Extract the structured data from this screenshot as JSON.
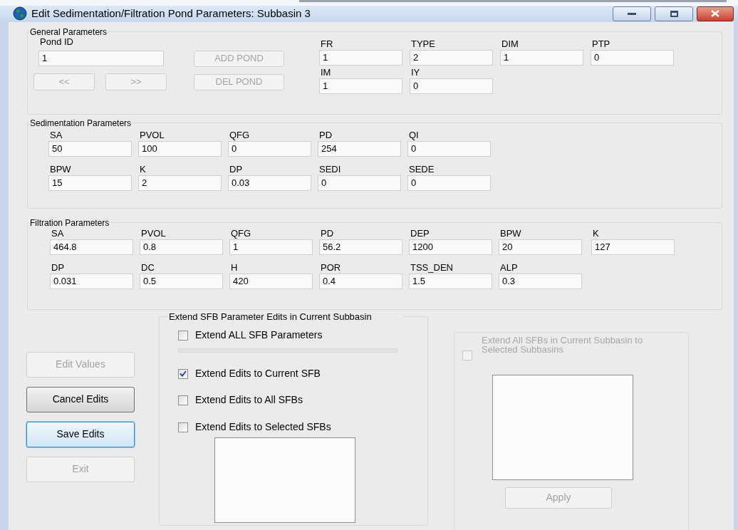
{
  "window": {
    "title": "Edit Sedimentation/Filtration Pond Parameters: Subbasin 3"
  },
  "general": {
    "title": "General Parameters",
    "pond_id": {
      "label": "Pond ID",
      "value": "1"
    },
    "buttons": [
      {
        "label": "ADD POND",
        "disabled": true
      },
      {
        "label": "<<",
        "disabled": true
      },
      {
        "label": ">>",
        "disabled": true
      },
      {
        "label": "DEL POND",
        "disabled": true
      }
    ],
    "rows": [
      [
        {
          "label": "FR",
          "value": "1"
        },
        {
          "label": "TYPE",
          "value": "2"
        },
        {
          "label": "DIM",
          "value": "1"
        },
        {
          "label": "PTP",
          "value": "0"
        }
      ],
      [
        {
          "label": "IM",
          "value": "1"
        },
        {
          "label": "IY",
          "value": "0"
        }
      ]
    ]
  },
  "sedimentation": {
    "title": "Sedimentation Parameters",
    "rows": [
      [
        {
          "label": "SA",
          "value": "50"
        },
        {
          "label": "PVOL",
          "value": "100"
        },
        {
          "label": "QFG",
          "value": "0"
        },
        {
          "label": "PD",
          "value": "254"
        },
        {
          "label": "QI",
          "value": "0"
        }
      ],
      [
        {
          "label": "BPW",
          "value": "15"
        },
        {
          "label": "K",
          "value": "2"
        },
        {
          "label": "DP",
          "value": "0.03"
        },
        {
          "label": "SEDI",
          "value": "0"
        },
        {
          "label": "SEDE",
          "value": "0"
        }
      ]
    ]
  },
  "filtration": {
    "title": "Filtration Parameters",
    "rows": [
      [
        {
          "label": "SA",
          "value": "464.8"
        },
        {
          "label": "PVOL",
          "value": "0.8"
        },
        {
          "label": "QFG",
          "value": "1"
        },
        {
          "label": "PD",
          "value": "56.2"
        },
        {
          "label": "DEP",
          "value": "1200"
        },
        {
          "label": "BPW",
          "value": "20"
        },
        {
          "label": "K",
          "value": "127"
        }
      ],
      [
        {
          "label": "DP",
          "value": "0.031"
        },
        {
          "label": "DC",
          "value": "0.5"
        },
        {
          "label": "H",
          "value": "420"
        },
        {
          "label": "POR",
          "value": "0.4"
        },
        {
          "label": "TSS_DEN",
          "value": "1.5"
        },
        {
          "label": "ALP",
          "value": "0.3"
        }
      ]
    ]
  },
  "actions": [
    {
      "label": "Edit Values",
      "disabled": true,
      "focused": false
    },
    {
      "label": "Cancel Edits",
      "disabled": false,
      "focused": false
    },
    {
      "label": "Save Edits",
      "disabled": false,
      "focused": true
    },
    {
      "label": "Exit",
      "disabled": true,
      "focused": false
    }
  ],
  "extend_current": {
    "title": "Extend SFB Parameter Edits in Current Subbasin",
    "options": [
      {
        "label": "Extend ALL SFB Parameters",
        "checked": false
      },
      {
        "label": "Extend Edits to Current SFB",
        "checked": true
      },
      {
        "label": "Extend Edits to All SFBs",
        "checked": false
      },
      {
        "label": "Extend Edits to Selected SFBs",
        "checked": false
      }
    ]
  },
  "extend_subbasins": {
    "label": "Extend All SFBs in Current Subbasin to Selected Subbasins",
    "checked": false,
    "disabled": true,
    "button": {
      "label": "Apply",
      "disabled": true
    }
  }
}
